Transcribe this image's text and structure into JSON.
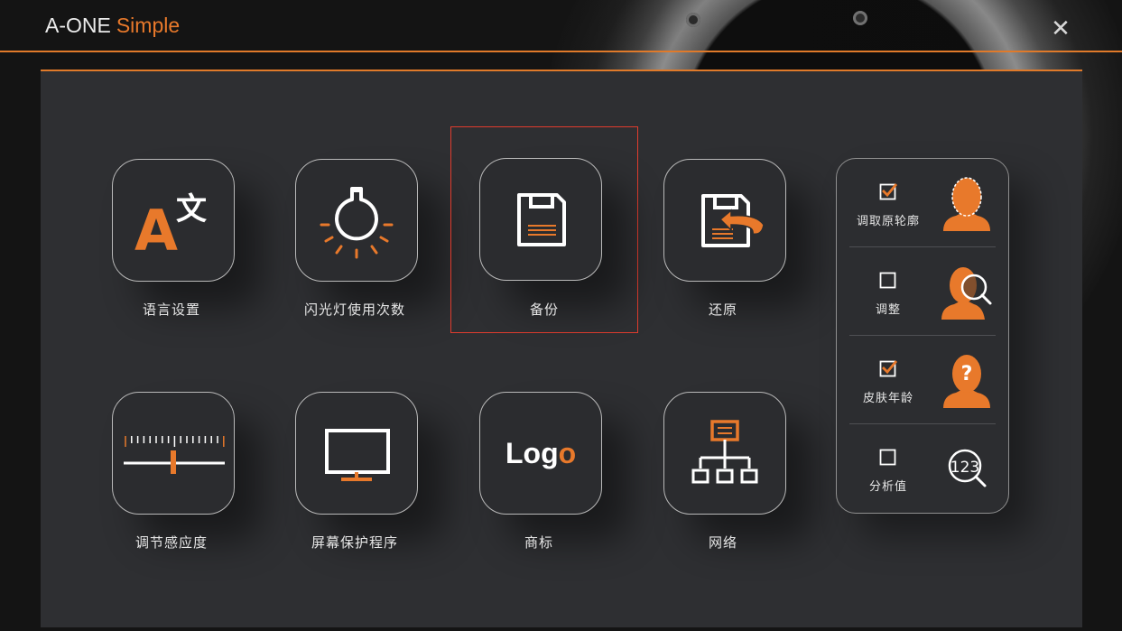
{
  "titlebar": {
    "brand_main": "A-ONE",
    "brand_sub": "Simple",
    "close_label": "✕"
  },
  "colors": {
    "accent": "#e8792b",
    "panel": "#2e2f32",
    "selection": "#e03c2e",
    "text": "#e6e6e6"
  },
  "tiles": [
    {
      "label": "语言设置",
      "icon": "translate-icon"
    },
    {
      "label": "闪光灯使用次数",
      "icon": "light-bulb-icon"
    },
    {
      "label": "备份",
      "icon": "floppy-disk-icon",
      "selected": true
    },
    {
      "label": "还原",
      "icon": "restore-disk-icon"
    },
    {
      "label": "调节感应度",
      "icon": "slider-ruler-icon"
    },
    {
      "label": "屏幕保护程序",
      "icon": "monitor-icon"
    },
    {
      "label": "商标",
      "icon": "logo-icon"
    },
    {
      "label": "网络",
      "icon": "network-icon"
    }
  ],
  "logo_icon_text": {
    "L": "L",
    "o1": "o",
    "g": "g",
    "o2": "o"
  },
  "side_options": [
    {
      "label": "调取原轮廓",
      "checked": true,
      "icon": "face-outline-icon"
    },
    {
      "label": "调整",
      "checked": false,
      "icon": "face-search-icon"
    },
    {
      "label": "皮肤年龄",
      "checked": true,
      "icon": "face-question-icon"
    },
    {
      "label": "分析值",
      "checked": false,
      "icon": "number-search-icon",
      "icon_text": "123"
    }
  ]
}
